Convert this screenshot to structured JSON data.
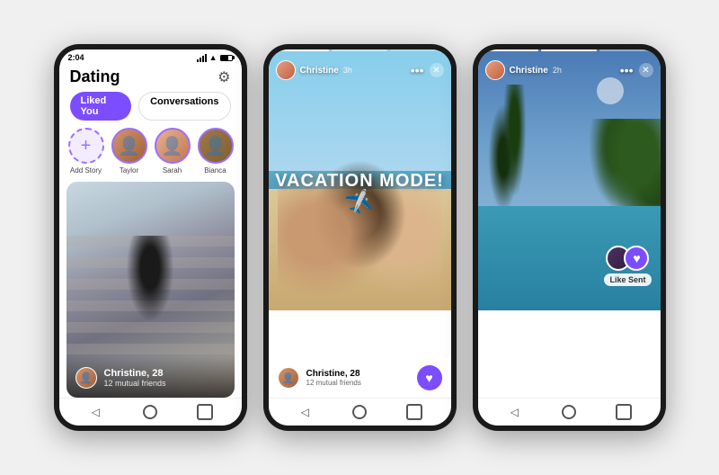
{
  "phones": [
    {
      "id": "phone1",
      "status_bar": {
        "time": "2:04",
        "icons": [
          "signal",
          "wifi",
          "battery"
        ]
      },
      "app": {
        "title": "Dating",
        "tab_liked": "Liked You",
        "tab_conversations": "Conversations",
        "active_tab": "conversations",
        "stories": [
          {
            "name": "Add Story",
            "type": "add"
          },
          {
            "name": "Taylor",
            "type": "avatar"
          },
          {
            "name": "Sarah",
            "type": "avatar"
          },
          {
            "name": "Bianca",
            "type": "avatar"
          }
        ],
        "profile": {
          "name": "Christine, 28",
          "mutual": "12 mutual friends"
        }
      }
    },
    {
      "id": "phone2",
      "status_bar": {
        "time": ""
      },
      "story": {
        "user": "Christine",
        "time_ago": "3h",
        "text_line1": "VACATION MODE!",
        "airplane": "✈",
        "profile_name": "Christine, 28",
        "mutual": "12 mutual friends"
      }
    },
    {
      "id": "phone3",
      "status_bar": {
        "time": ""
      },
      "story": {
        "user": "Christine",
        "time_ago": "2h",
        "like_sent_label": "Like Sent"
      }
    }
  ],
  "colors": {
    "purple": "#7c4dff",
    "light_purple": "#9c6fff",
    "bg": "#f0f0f0"
  }
}
